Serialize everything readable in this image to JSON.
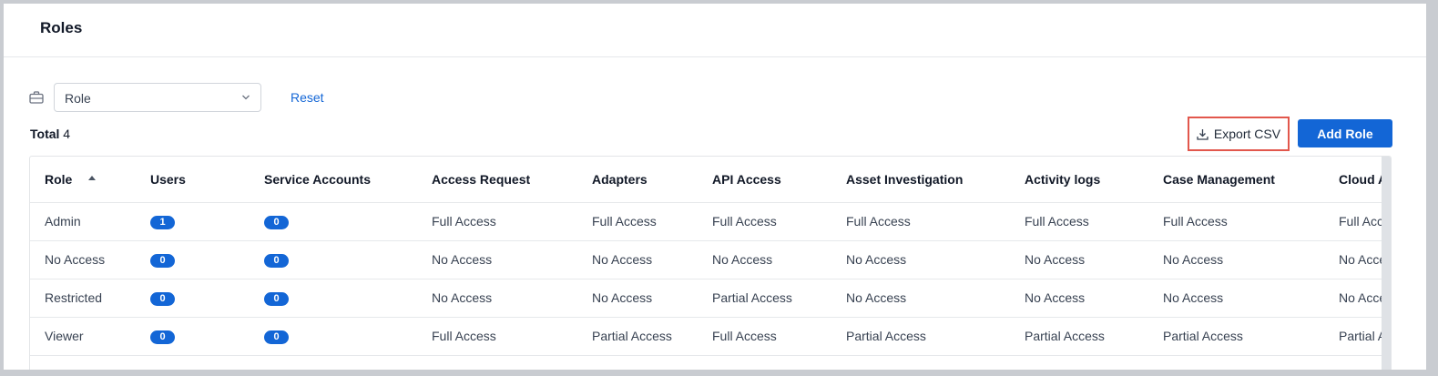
{
  "page": {
    "title": "Roles"
  },
  "filter": {
    "icon": "briefcase-icon",
    "role_select_value": "Role",
    "reset_label": "Reset"
  },
  "summary": {
    "total_label": "Total",
    "total_value": "4"
  },
  "toolbar": {
    "export_label": "Export CSV",
    "export_icon": "download-icon",
    "add_role_label": "Add Role",
    "add_role_color": "#1366d6",
    "highlight_color": "#e2574c"
  },
  "table": {
    "sorted_column": "Role",
    "sort_direction": "ascending",
    "columns": [
      "Role",
      "Users",
      "Service Accounts",
      "Access Request",
      "Adapters",
      "API Access",
      "Asset Investigation",
      "Activity logs",
      "Case Management",
      "Cloud Asset Compliance"
    ],
    "rows": [
      {
        "role": "Admin",
        "users": "1",
        "service_accounts": "0",
        "access_request": "Full Access",
        "adapters": "Full Access",
        "api_access": "Full Access",
        "asset_investigation": "Full Access",
        "activity_logs": "Full Access",
        "case_management": "Full Access",
        "cloud_asset": "Full Access"
      },
      {
        "role": "No Access",
        "users": "0",
        "service_accounts": "0",
        "access_request": "No Access",
        "adapters": "No Access",
        "api_access": "No Access",
        "asset_investigation": "No Access",
        "activity_logs": "No Access",
        "case_management": "No Access",
        "cloud_asset": "No Access"
      },
      {
        "role": "Restricted",
        "users": "0",
        "service_accounts": "0",
        "access_request": "No Access",
        "adapters": "No Access",
        "api_access": "Partial Access",
        "asset_investigation": "No Access",
        "activity_logs": "No Access",
        "case_management": "No Access",
        "cloud_asset": "No Access"
      },
      {
        "role": "Viewer",
        "users": "0",
        "service_accounts": "0",
        "access_request": "Full Access",
        "adapters": "Partial Access",
        "api_access": "Full Access",
        "asset_investigation": "Partial Access",
        "activity_logs": "Partial Access",
        "case_management": "Partial Access",
        "cloud_asset": "Partial Access"
      }
    ]
  }
}
